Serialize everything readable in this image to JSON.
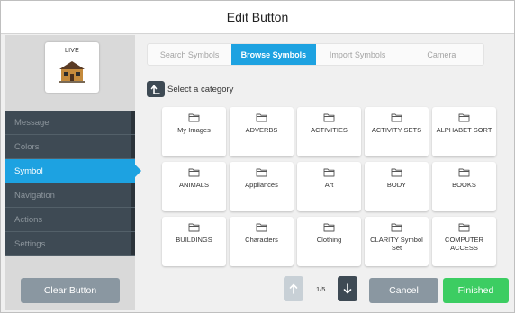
{
  "window": {
    "title": "Edit Button"
  },
  "preview": {
    "live_label": "LIVE",
    "symbol_icon": "house-icon"
  },
  "sidebar": {
    "items": [
      {
        "label": "Message",
        "active": false
      },
      {
        "label": "Colors",
        "active": false
      },
      {
        "label": "Symbol",
        "active": true
      },
      {
        "label": "Navigation",
        "active": false
      },
      {
        "label": "Actions",
        "active": false
      },
      {
        "label": "Settings",
        "active": false
      }
    ],
    "clear_label": "Clear Button"
  },
  "tabs": [
    {
      "label": "Search Symbols",
      "active": false
    },
    {
      "label": "Browse Symbols",
      "active": true
    },
    {
      "label": "Import Symbols",
      "active": false
    },
    {
      "label": "Camera",
      "active": false
    }
  ],
  "category": {
    "label": "Select a category",
    "up_icon": "arrow-up-return-icon"
  },
  "categories": [
    "My Images",
    "ADVERBS",
    "ACTIVITIES",
    "ACTIVITY SETS",
    "ALPHABET SORT",
    "ANIMALS",
    "Appliances",
    "Art",
    "BODY",
    "BOOKS",
    "BUILDINGS",
    "Characters",
    "Clothing",
    "CLARITY Symbol Set",
    "COMPUTER ACCESS"
  ],
  "tile_icon": "folder-icon",
  "pager": {
    "page": "1/5",
    "prev_icon": "arrow-up-icon",
    "next_icon": "arrow-down-icon"
  },
  "footer": {
    "cancel_label": "Cancel",
    "finished_label": "Finished"
  },
  "colors": {
    "accent": "#1da2e1",
    "sidebar": "#3e4a54",
    "finished": "#3ccd62",
    "neutral_button": "#8a97a1"
  }
}
